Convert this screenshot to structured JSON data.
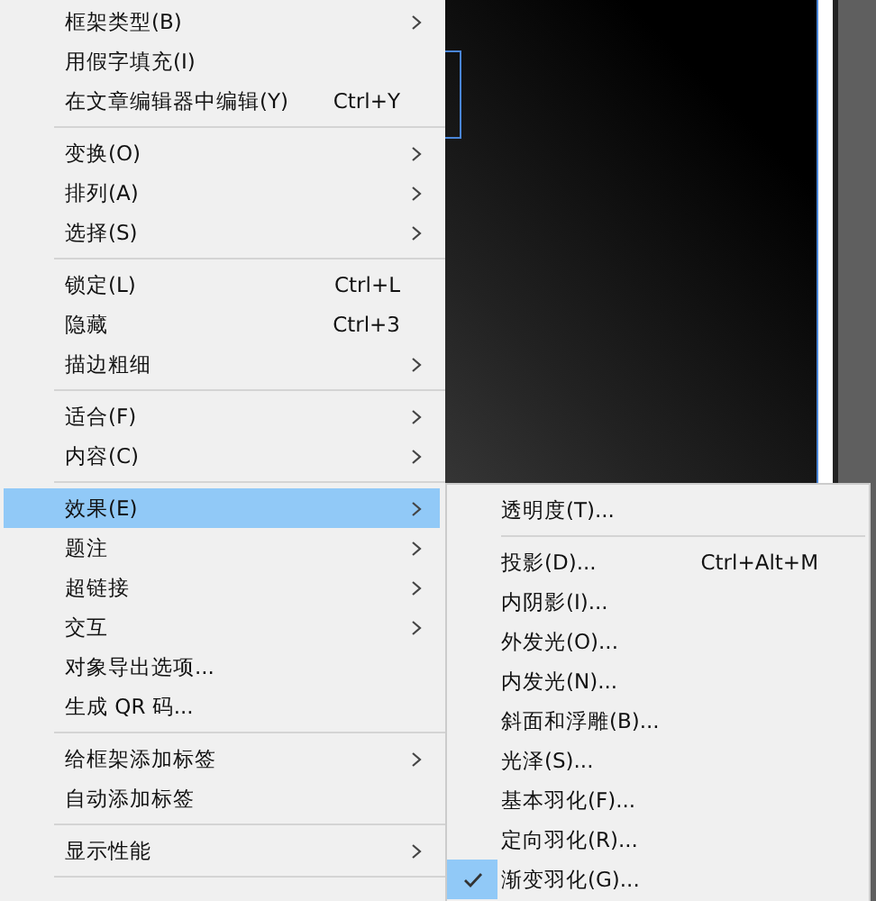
{
  "context_menu": {
    "items": [
      {
        "kind": "item",
        "label": "框架类型(B)",
        "has_submenu": true,
        "selected": false
      },
      {
        "kind": "item",
        "label": "用假字填充(I)",
        "has_submenu": false,
        "selected": false
      },
      {
        "kind": "item",
        "label": "在文章编辑器中编辑(Y)",
        "shortcut": "Ctrl+Y",
        "has_submenu": false,
        "selected": false
      },
      {
        "kind": "separator"
      },
      {
        "kind": "item",
        "label": "变换(O)",
        "has_submenu": true,
        "selected": false
      },
      {
        "kind": "item",
        "label": "排列(A)",
        "has_submenu": true,
        "selected": false
      },
      {
        "kind": "item",
        "label": "选择(S)",
        "has_submenu": true,
        "selected": false
      },
      {
        "kind": "separator"
      },
      {
        "kind": "item",
        "label": "锁定(L)",
        "shortcut": "Ctrl+L",
        "has_submenu": false,
        "selected": false
      },
      {
        "kind": "item",
        "label": "隐藏",
        "shortcut": "Ctrl+3",
        "has_submenu": false,
        "selected": false
      },
      {
        "kind": "item",
        "label": "描边粗细",
        "has_submenu": true,
        "selected": false
      },
      {
        "kind": "separator"
      },
      {
        "kind": "item",
        "label": "适合(F)",
        "has_submenu": true,
        "selected": false
      },
      {
        "kind": "item",
        "label": "内容(C)",
        "has_submenu": true,
        "selected": false
      },
      {
        "kind": "separator"
      },
      {
        "kind": "item",
        "label": "效果(E)",
        "has_submenu": true,
        "selected": true
      },
      {
        "kind": "item",
        "label": "题注",
        "has_submenu": true,
        "selected": false
      },
      {
        "kind": "item",
        "label": "超链接",
        "has_submenu": true,
        "selected": false
      },
      {
        "kind": "item",
        "label": "交互",
        "has_submenu": true,
        "selected": false
      },
      {
        "kind": "item",
        "label": "对象导出选项...",
        "has_submenu": false,
        "selected": false
      },
      {
        "kind": "item",
        "label": "生成 QR 码...",
        "has_submenu": false,
        "selected": false
      },
      {
        "kind": "separator"
      },
      {
        "kind": "item",
        "label": "给框架添加标签",
        "has_submenu": true,
        "selected": false
      },
      {
        "kind": "item",
        "label": "自动添加标签",
        "has_submenu": false,
        "selected": false
      },
      {
        "kind": "separator"
      },
      {
        "kind": "item",
        "label": "显示性能",
        "has_submenu": true,
        "selected": false
      },
      {
        "kind": "separator"
      }
    ]
  },
  "effects_submenu": {
    "items": [
      {
        "kind": "item",
        "label": "透明度(T)...",
        "checked": false
      },
      {
        "kind": "separator"
      },
      {
        "kind": "item",
        "label": "投影(D)...",
        "shortcut": "Ctrl+Alt+M",
        "checked": false
      },
      {
        "kind": "item",
        "label": "内阴影(I)...",
        "checked": false
      },
      {
        "kind": "item",
        "label": "外发光(O)...",
        "checked": false
      },
      {
        "kind": "item",
        "label": "内发光(N)...",
        "checked": false
      },
      {
        "kind": "item",
        "label": "斜面和浮雕(B)...",
        "checked": false
      },
      {
        "kind": "item",
        "label": "光泽(S)...",
        "checked": false
      },
      {
        "kind": "item",
        "label": "基本羽化(F)...",
        "checked": false
      },
      {
        "kind": "item",
        "label": "定向羽化(R)...",
        "checked": false
      },
      {
        "kind": "item",
        "label": "渐变羽化(G)...",
        "checked": true
      }
    ]
  }
}
